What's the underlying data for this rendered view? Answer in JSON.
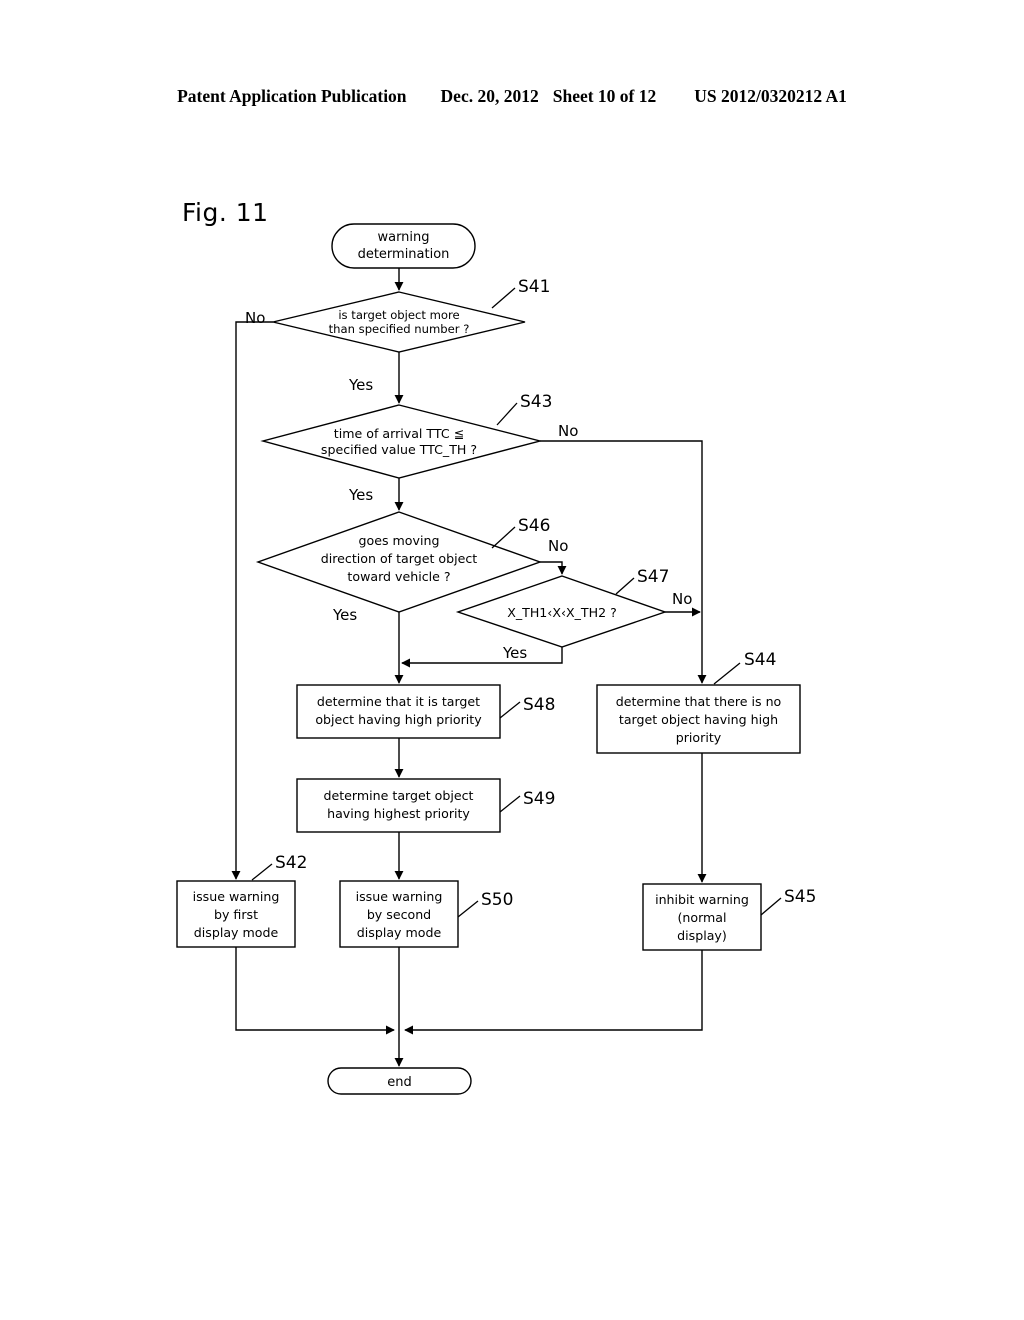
{
  "header": {
    "publication": "Patent Application Publication",
    "date": "Dec. 20, 2012",
    "sheet": "Sheet 10 of 12",
    "patent_number": "US 2012/0320212 A1"
  },
  "figure": {
    "label": "Fig. 11"
  },
  "flowchart": {
    "start": {
      "line1": "warning",
      "line2": "determination"
    },
    "end": {
      "label": "end"
    },
    "decisions": [
      {
        "id": "S41",
        "step": "S41",
        "line1": "is target object more",
        "line2": "than specified number ?",
        "yes": "Yes",
        "no": "No"
      },
      {
        "id": "S43",
        "step": "S43",
        "line1": "time of arrival TTC ≦",
        "line2": "specified value TTC_TH ?",
        "yes": "Yes",
        "no": "No"
      },
      {
        "id": "S46",
        "step": "S46",
        "line1": "goes moving",
        "line2": "direction of target object",
        "line3": "toward vehicle ?",
        "yes": "Yes",
        "no": "No"
      },
      {
        "id": "S47",
        "step": "S47",
        "line1": "X_TH1‹X‹X_TH2 ?",
        "yes": "Yes",
        "no": "No"
      }
    ],
    "processes": [
      {
        "id": "S48",
        "step": "S48",
        "line1": "determine that it is target",
        "line2": "object having high priority"
      },
      {
        "id": "S49",
        "step": "S49",
        "line1": "determine target object",
        "line2": "having highest priority"
      },
      {
        "id": "S44",
        "step": "S44",
        "line1": "determine that there is no",
        "line2": "target object having high",
        "line3": "priority"
      },
      {
        "id": "S42",
        "step": "S42",
        "line1": "issue warning",
        "line2": "by first",
        "line3": "display mode"
      },
      {
        "id": "S50",
        "step": "S50",
        "line1": "issue warning",
        "line2": "by second",
        "line3": "display mode"
      },
      {
        "id": "S45",
        "step": "S45",
        "line1": "inhibit warning",
        "line2": "(normal",
        "line3": "display)"
      }
    ],
    "colors": {
      "line": "#000000",
      "fill": "#ffffff",
      "text": "#000000"
    }
  }
}
